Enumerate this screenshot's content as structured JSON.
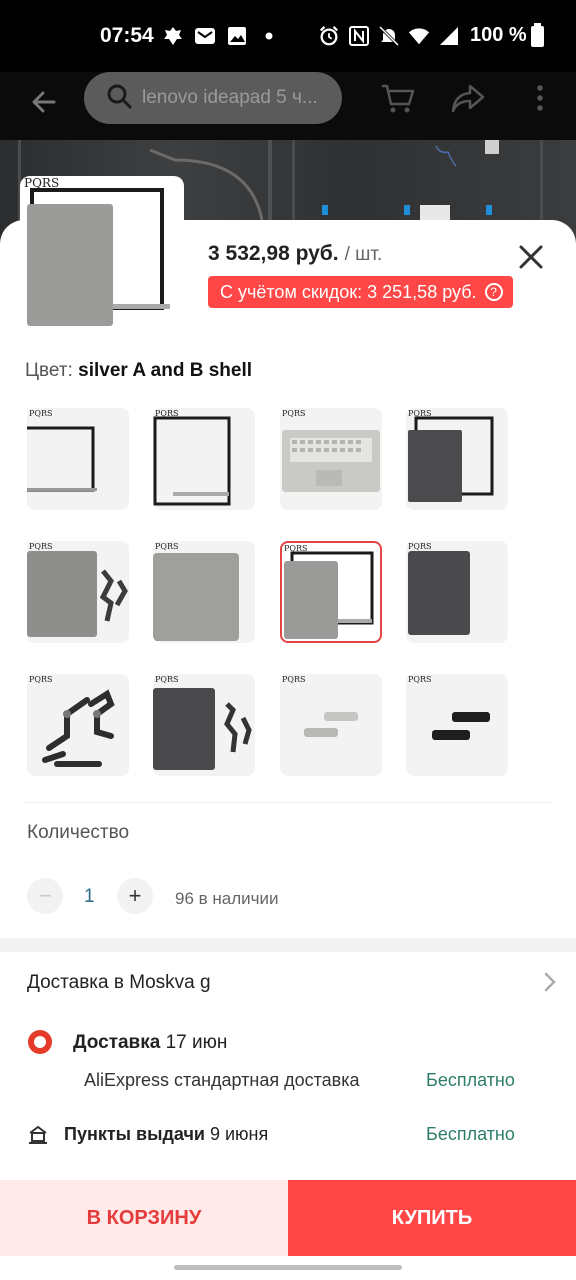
{
  "status_bar": {
    "time": "07:54",
    "battery": "100 %",
    "icons": [
      "emblem-icon",
      "mail-icon",
      "image-icon",
      "dot-icon",
      "alarm-icon",
      "nfc-icon",
      "mute-icon",
      "wifi-icon",
      "signal-icon",
      "battery-icon"
    ]
  },
  "toolbar": {
    "search_text": "lenovo ideapad 5 ч...",
    "icons": [
      "back-arrow-icon",
      "search-icon",
      "cart-icon",
      "share-icon",
      "more-icon"
    ]
  },
  "product": {
    "price": "3 532,98 руб.",
    "price_unit": "/ шт.",
    "discount_text": "С учётом скидок: 3 251,58 руб.",
    "color_label": "Цвет:",
    "color_value": "silver A and B shell",
    "brand_mark": "PQRS"
  },
  "swatches": [
    {
      "kind": "bezel-hinge-strip"
    },
    {
      "kind": "bezel-black"
    },
    {
      "kind": "palmrest-keyboard"
    },
    {
      "kind": "dark-lid-bezel"
    },
    {
      "kind": "silver-lid-hinges"
    },
    {
      "kind": "silver-lid"
    },
    {
      "kind": "silver-lid-bezel",
      "selected": true
    },
    {
      "kind": "dark-lid"
    },
    {
      "kind": "hinges"
    },
    {
      "kind": "dark-lid-hinges"
    },
    {
      "kind": "silver-hinge-covers"
    },
    {
      "kind": "black-hinge-covers"
    }
  ],
  "quantity": {
    "label": "Количество",
    "minus": "−",
    "value": "1",
    "plus": "+",
    "stock": "96 в наличии"
  },
  "delivery": {
    "to_label": "Доставка в Moskva g",
    "option_title": "Доставка",
    "option_date": "17 июн",
    "method": "AliExpress стандартная доставка",
    "method_price": "Бесплатно",
    "pickup_title": "Пункты выдачи",
    "pickup_date": "9 июня",
    "pickup_price": "Бесплатно"
  },
  "actions": {
    "cart": "В КОРЗИНУ",
    "buy": "КУПИТЬ"
  },
  "colors": {
    "accent": "#ff4747",
    "free_green": "#2e7d6b",
    "cart_bg": "#ffe9e9"
  }
}
